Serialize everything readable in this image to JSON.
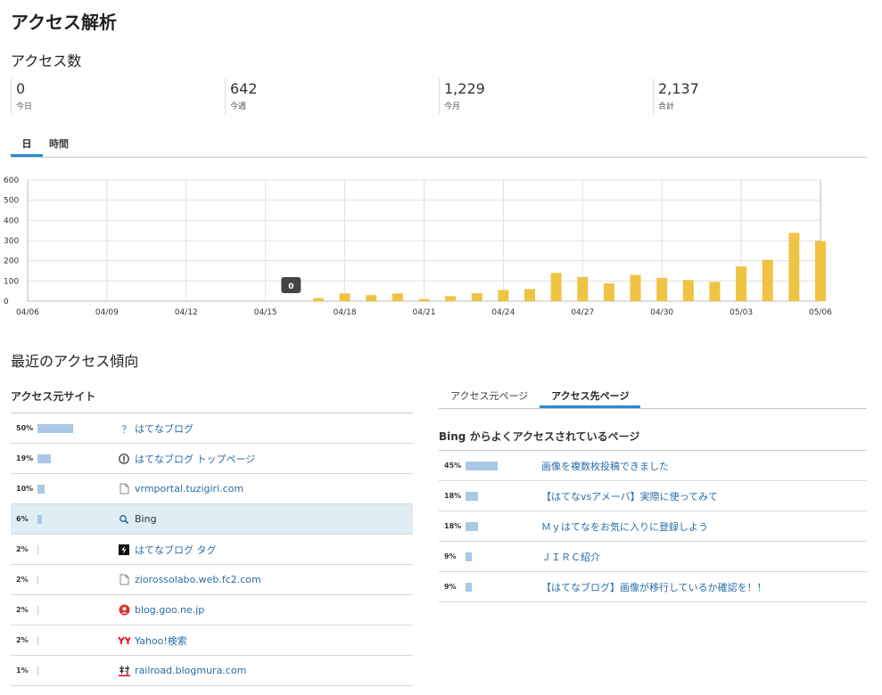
{
  "page_title": "アクセス解析",
  "access_count": {
    "title": "アクセス数",
    "stats": [
      {
        "value": "0",
        "label": "今日"
      },
      {
        "value": "642",
        "label": "今週"
      },
      {
        "value": "1,229",
        "label": "今月"
      },
      {
        "value": "2,137",
        "label": "合計"
      }
    ]
  },
  "chart_tabs": [
    {
      "label": "日",
      "active": true
    },
    {
      "label": "時間",
      "active": false
    }
  ],
  "chart_data": {
    "type": "bar",
    "ylim": [
      0,
      600
    ],
    "yticks": [
      "0",
      "100",
      "200",
      "300",
      "400",
      "500",
      "600"
    ],
    "xtick_labels": [
      "04/06",
      "04/09",
      "04/12",
      "04/15",
      "04/18",
      "04/21",
      "04/24",
      "04/27",
      "04/30",
      "05/03",
      "05/06"
    ],
    "categories": [
      "04/06",
      "04/07",
      "04/08",
      "04/09",
      "04/10",
      "04/11",
      "04/12",
      "04/13",
      "04/14",
      "04/15",
      "04/16",
      "04/17",
      "04/18",
      "04/19",
      "04/20",
      "04/21",
      "04/22",
      "04/23",
      "04/24",
      "04/25",
      "04/26",
      "04/27",
      "04/28",
      "04/29",
      "04/30",
      "05/01",
      "05/02",
      "05/03",
      "05/04",
      "05/05",
      "05/06"
    ],
    "values": [
      0,
      0,
      0,
      0,
      0,
      0,
      0,
      0,
      0,
      0,
      0,
      15,
      38,
      30,
      38,
      10,
      25,
      40,
      55,
      60,
      140,
      120,
      88,
      130,
      115,
      105,
      95,
      172,
      205,
      338,
      298
    ],
    "tooltip": "0",
    "bar_color": "#f0c342"
  },
  "recent": {
    "title": "最近のアクセス傾向",
    "referrers_title": "アクセス元サイト",
    "referrers": [
      {
        "pct": "50%",
        "value": 50,
        "icon": "hatena-blog-icon",
        "label": "はてなブログ"
      },
      {
        "pct": "19%",
        "value": 19,
        "icon": "hatena-top-icon",
        "label": "はてなブログ トップページ"
      },
      {
        "pct": "10%",
        "value": 10,
        "icon": "page-icon",
        "label": "vrmportal.tuzigiri.com"
      },
      {
        "pct": "6%",
        "value": 6,
        "icon": "search-icon",
        "label": "Bing",
        "selected": true
      },
      {
        "pct": "2%",
        "value": 2,
        "icon": "tag-icon",
        "label": "はてなブログ タグ"
      },
      {
        "pct": "2%",
        "value": 2,
        "icon": "page-icon",
        "label": "ziorossolabo.web.fc2.com"
      },
      {
        "pct": "2%",
        "value": 2,
        "icon": "goo-icon",
        "label": "blog.goo.ne.jp"
      },
      {
        "pct": "2%",
        "value": 2,
        "icon": "yahoo-icon",
        "label": "Yahoo!検索"
      },
      {
        "pct": "1%",
        "value": 1,
        "icon": "blogmura-icon",
        "label": "railroad.blogmura.com"
      }
    ],
    "page_tabs": [
      {
        "label": "アクセス元ページ",
        "active": false
      },
      {
        "label": "アクセス先ページ",
        "active": true
      }
    ],
    "dest_title": "Bing からよくアクセスされているページ",
    "dest_pages": [
      {
        "pct": "45%",
        "value": 45,
        "label": "画像を複数枚投稿できました"
      },
      {
        "pct": "18%",
        "value": 18,
        "label": "【はてなvsアメーバ】実際に使ってみて"
      },
      {
        "pct": "18%",
        "value": 18,
        "label": "Ｍｙはてなをお気に入りに登録しよう"
      },
      {
        "pct": "9%",
        "value": 9,
        "label": "ＪＩＲＣ紹介"
      },
      {
        "pct": "9%",
        "value": 9,
        "label": "【はてなブログ】画像が移行しているか確認を！！"
      }
    ]
  }
}
